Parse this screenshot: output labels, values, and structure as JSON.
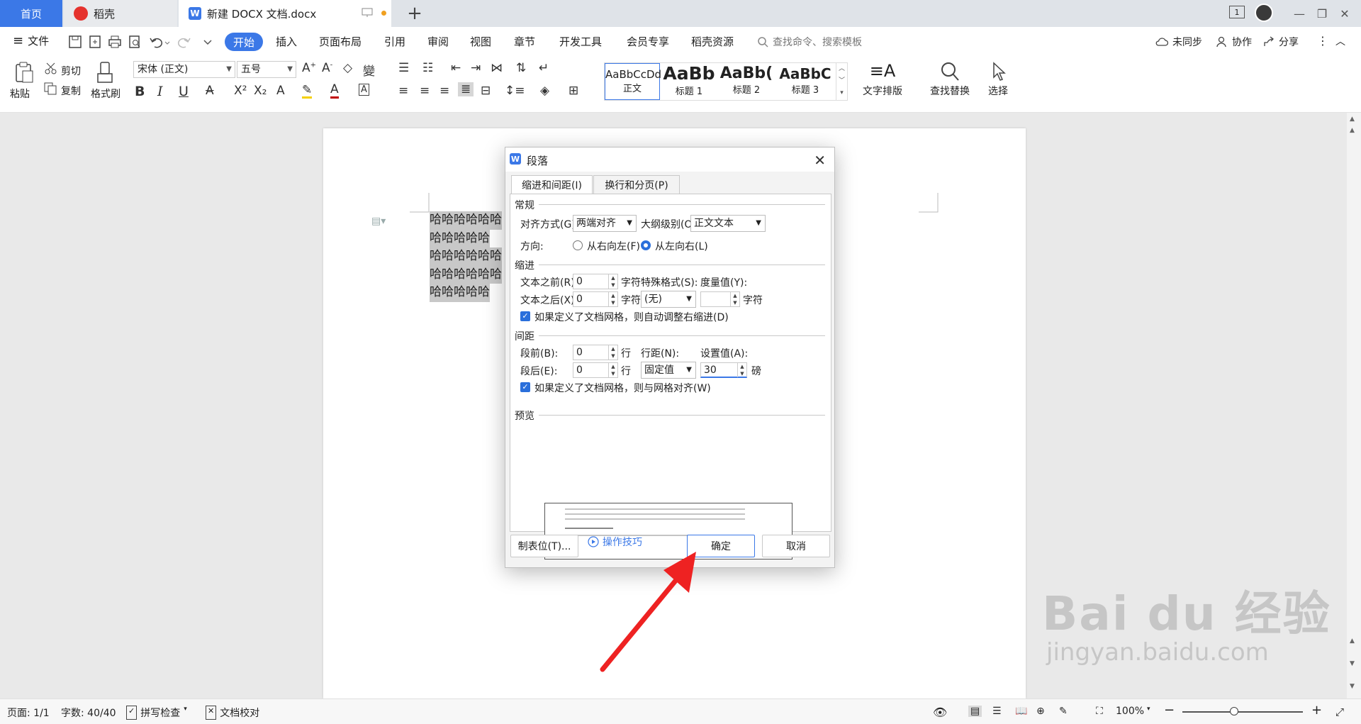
{
  "tabs": {
    "home": "首页",
    "dake": "稻壳",
    "doc": "新建 DOCX 文档.docx",
    "add": "+"
  },
  "window": {
    "badge": "1"
  },
  "menu": {
    "file": "文件",
    "items": [
      "开始",
      "插入",
      "页面布局",
      "引用",
      "审阅",
      "视图",
      "章节",
      "开发工具",
      "会员专享",
      "稻壳资源"
    ],
    "search_placeholder": "查找命令、搜索模板",
    "sync": "未同步",
    "collab": "协作",
    "share": "分享"
  },
  "ribbon": {
    "paste": "粘贴",
    "cut": "剪切",
    "copy": "复制",
    "format_painter": "格式刷",
    "font_name": "宋体 (正文)",
    "font_size": "五号",
    "styles": [
      {
        "preview": "AaBbCcDd",
        "name": "正文"
      },
      {
        "preview": "AaBb",
        "name": "标题 1"
      },
      {
        "preview": "AaBb(",
        "name": "标题 2"
      },
      {
        "preview": "AaBbC",
        "name": "标题 3"
      }
    ],
    "text_layout": "文字排版",
    "find_replace": "查找替换",
    "select": "选择"
  },
  "document": {
    "lines": [
      "哈哈哈哈哈哈",
      "哈哈哈哈哈",
      "哈哈哈哈哈哈",
      "哈哈哈哈哈哈",
      "哈哈哈哈哈"
    ]
  },
  "dialog": {
    "title": "段落",
    "tab_indent": "缩进和间距(I)",
    "tab_break": "换行和分页(P)",
    "general": "常规",
    "alignment_label": "对齐方式(G):",
    "alignment_value": "两端对齐",
    "outline_label": "大纲级别(O):",
    "outline_value": "正文文本",
    "direction_label": "方向:",
    "rtl": "从右向左(F)",
    "ltr": "从左向右(L)",
    "indent": "缩进",
    "before_text_label": "文本之前(R):",
    "before_text_value": "0",
    "after_text_label": "文本之后(X):",
    "after_text_value": "0",
    "unit_char": "字符",
    "special_label": "特殊格式(S):",
    "special_value": "(无)",
    "measure_label": "度量值(Y):",
    "measure_value": "",
    "auto_indent": "如果定义了文档网格，则自动调整右缩进(D)",
    "spacing": "间距",
    "before_label": "段前(B):",
    "before_value": "0",
    "after_label": "段后(E):",
    "after_value": "0",
    "unit_line": "行",
    "line_spacing_label": "行距(N):",
    "line_spacing_value": "固定值",
    "set_value_label": "设置值(A):",
    "set_value_value": "30",
    "unit_pt": "磅",
    "grid_align": "如果定义了文档网格，则与网格对齐(W)",
    "preview": "预览",
    "tabs_button": "制表位(T)...",
    "tips": "操作技巧",
    "ok": "确定",
    "cancel": "取消"
  },
  "status": {
    "page": "页面: 1/1",
    "words": "字数: 40/40",
    "spell": "拼写检查",
    "proof": "文档校对",
    "zoom": "100%",
    "zoom_level": 0.43
  },
  "watermark": {
    "main": "Bai du 经验",
    "sub": "jingyan.baidu.com"
  }
}
